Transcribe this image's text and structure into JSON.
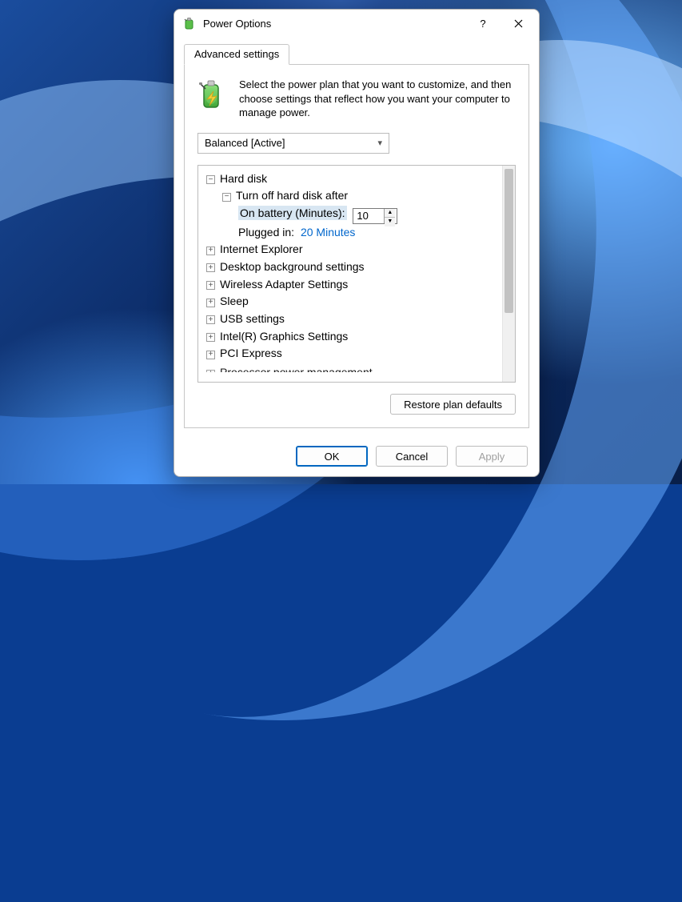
{
  "titlebar": {
    "title": "Power Options",
    "help_label": "?",
    "close_label": "✕"
  },
  "tabs": {
    "advanced": "Advanced settings"
  },
  "intro": "Select the power plan that you want to customize, and then choose settings that reflect how you want your computer to manage power.",
  "plan_selected": "Balanced [Active]",
  "tree": {
    "hard_disk": "Hard disk",
    "turn_off_after": "Turn off hard disk after",
    "on_battery_label": "On battery (Minutes):",
    "on_battery_value": "10",
    "plugged_in_label": "Plugged in:",
    "plugged_in_value": "20 Minutes",
    "ie": "Internet Explorer",
    "desktop_bg": "Desktop background settings",
    "wireless": "Wireless Adapter Settings",
    "sleep": "Sleep",
    "usb": "USB settings",
    "intel_gfx": "Intel(R) Graphics Settings",
    "pci": "PCI Express",
    "processor": "Processor power management"
  },
  "buttons": {
    "restore": "Restore plan defaults",
    "ok": "OK",
    "cancel": "Cancel",
    "apply": "Apply"
  }
}
